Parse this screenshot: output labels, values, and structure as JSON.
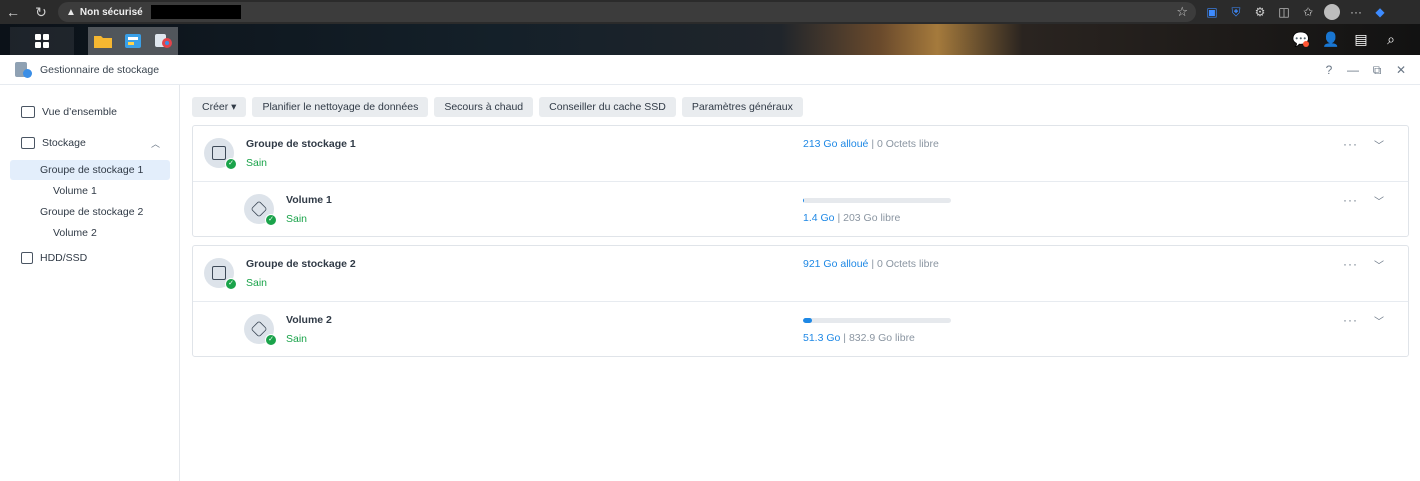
{
  "browser": {
    "security_label": "Non sécurisé"
  },
  "window": {
    "title": "Gestionnaire de stockage",
    "help": "?",
    "minimize": "—",
    "restore": "⧉",
    "close": "✕"
  },
  "sidebar": {
    "items": [
      {
        "label": "Vue d’ensemble"
      },
      {
        "label": "Stockage"
      },
      {
        "label": "Groupe de stockage 1"
      },
      {
        "label": "Volume 1"
      },
      {
        "label": "Groupe de stockage 2"
      },
      {
        "label": "Volume 2"
      },
      {
        "label": "HDD/SSD"
      }
    ]
  },
  "toolbar": {
    "create": "Créer ▾",
    "schedule": "Planifier le nettoyage de données",
    "hot_spare": "Secours à chaud",
    "ssd_advisor": "Conseiller du cache SSD",
    "settings": "Paramètres généraux"
  },
  "pools": [
    {
      "name": "Groupe de stockage 1",
      "status": "Sain",
      "allocated": "213 Go alloué",
      "free": "| 0 Octets libre",
      "volume": {
        "name": "Volume 1",
        "status": "Sain",
        "used": "1.4 Go",
        "free": "| 203 Go libre",
        "usage_fraction": 0.007
      }
    },
    {
      "name": "Groupe de stockage 2",
      "status": "Sain",
      "allocated": "921 Go alloué",
      "free": "| 0 Octets libre",
      "volume": {
        "name": "Volume 2",
        "status": "Sain",
        "used": "51.3 Go",
        "free": "| 832.9 Go libre",
        "usage_fraction": 0.058
      }
    }
  ],
  "colors": {
    "accent": "#1e88e5",
    "healthy": "#1aa34a"
  }
}
